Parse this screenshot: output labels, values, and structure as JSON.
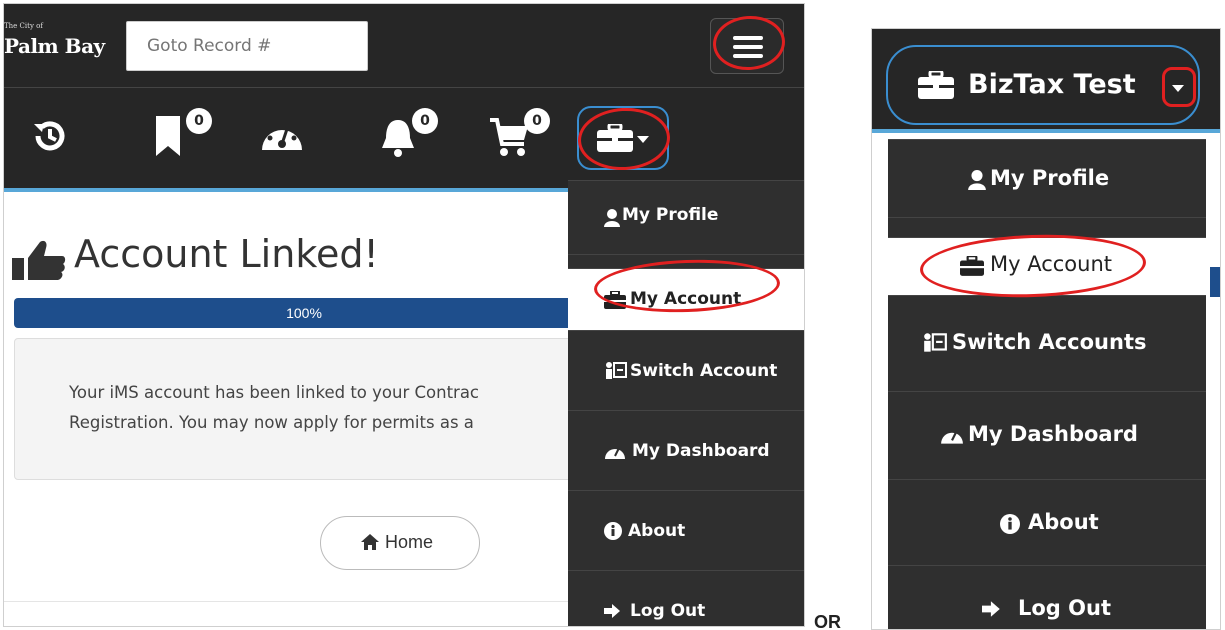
{
  "left_screen": {
    "logo_small": "The City of",
    "logo_big": "Palm Bay",
    "goto_placeholder": "Goto Record #",
    "icons": {
      "history": "history-icon",
      "bookmark": "bookmark-icon",
      "dashboard": "dashboard-icon",
      "bell": "bell-icon",
      "cart": "cart-icon",
      "briefcase": "briefcase-icon",
      "menu": "hamburger-menu-icon"
    },
    "badges": {
      "bookmark": "0",
      "bell": "0",
      "cart": "0"
    },
    "page_title": "Account Linked!",
    "progress_label": "100%",
    "progress_value": 100,
    "info_line1": "Your iMS account has been linked to your Contrac",
    "info_line2": "Registration. You may now apply for permits as a",
    "home_button": "Home",
    "menu": [
      {
        "label": "My Profile",
        "icon": "user-icon"
      },
      {
        "label": "My Account",
        "icon": "briefcase-icon",
        "active": true
      },
      {
        "label": "Switch Account",
        "icon": "switch-accounts-icon"
      },
      {
        "label": "My Dashboard",
        "icon": "dashboard-icon"
      },
      {
        "label": "About",
        "icon": "info-icon"
      },
      {
        "label": "Log Out",
        "icon": "logout-icon"
      }
    ]
  },
  "separator_text": "OR",
  "right_screen": {
    "account_name": "BizTax Test",
    "menu": [
      {
        "label": "My Profile",
        "icon": "user-icon"
      },
      {
        "label": "My Account",
        "icon": "briefcase-icon",
        "active": true
      },
      {
        "label": "Switch Accounts",
        "icon": "switch-accounts-icon"
      },
      {
        "label": "My Dashboard",
        "icon": "dashboard-icon"
      },
      {
        "label": "About",
        "icon": "info-icon"
      },
      {
        "label": "Log Out",
        "icon": "logout-icon"
      }
    ]
  },
  "colors": {
    "navbar": "#262626",
    "menu_bg": "#2f2f2f",
    "accent_blue": "#58a7d8",
    "progress_blue": "#1e4e8c",
    "annotation_red": "#e02020"
  }
}
